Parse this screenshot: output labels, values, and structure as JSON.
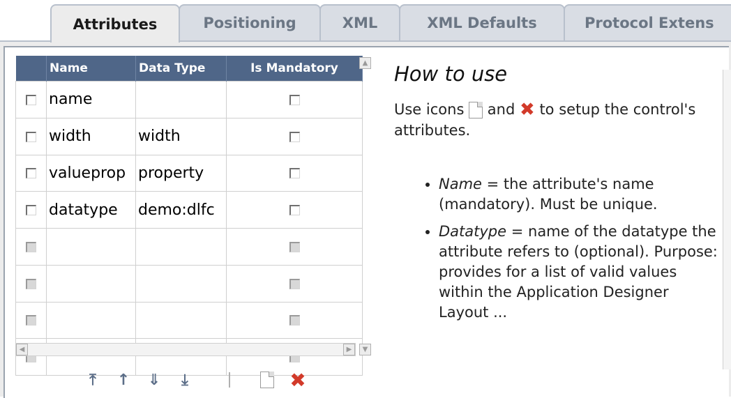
{
  "tabs": [
    {
      "label": "Attributes"
    },
    {
      "label": "Positioning"
    },
    {
      "label": "XML"
    },
    {
      "label": "XML Defaults"
    },
    {
      "label": "Protocol Extens"
    }
  ],
  "grid": {
    "columns": [
      "Name",
      "Data Type",
      "Is Mandatory"
    ],
    "rows": [
      {
        "name": "name",
        "type": "",
        "mandatory": false,
        "enabled": true
      },
      {
        "name": "width",
        "type": "width",
        "mandatory": false,
        "enabled": true
      },
      {
        "name": "valueprop",
        "type": "property",
        "mandatory": false,
        "enabled": true
      },
      {
        "name": "datatype",
        "type": "demo:dlfc",
        "mandatory": false,
        "enabled": true
      },
      {
        "name": "",
        "type": "",
        "mandatory": false,
        "enabled": false
      },
      {
        "name": "",
        "type": "",
        "mandatory": false,
        "enabled": false
      },
      {
        "name": "",
        "type": "",
        "mandatory": false,
        "enabled": false
      },
      {
        "name": "",
        "type": "",
        "mandatory": false,
        "enabled": false
      }
    ]
  },
  "toolbar": {
    "icons": [
      "move-top-icon",
      "move-up-icon",
      "move-down-icon",
      "move-bottom-icon",
      "new-icon",
      "delete-icon"
    ]
  },
  "help": {
    "title": "How to use",
    "intro_1": "Use icons",
    "intro_2": "and",
    "intro_3": "to setup the control's attributes.",
    "items": [
      {
        "term": "Name",
        "text": " = the attribute's name (mandatory). Must be unique."
      },
      {
        "term": "Datatype",
        "text": " = name of the datatype the attribute refers to (optional). Purpose: provides for a list of valid values within the Application Designer Layout ..."
      }
    ]
  },
  "colors": {
    "header_bg": "#4f6688",
    "delete_red": "#d23a2a"
  }
}
